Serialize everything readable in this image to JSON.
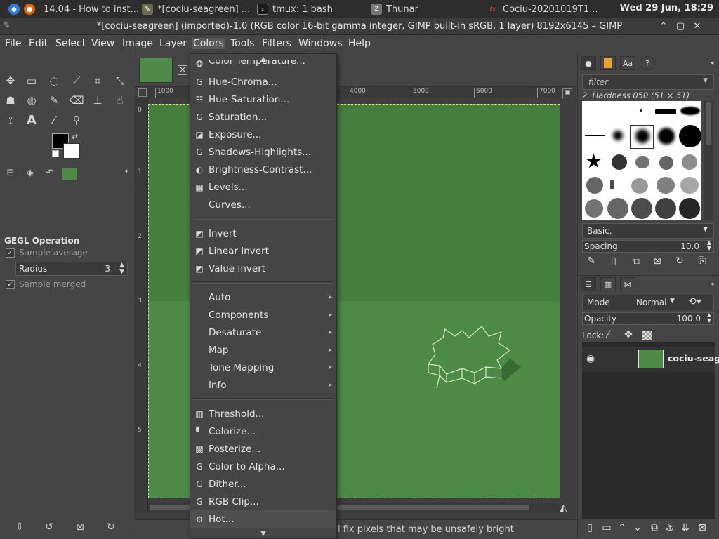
{
  "taskbar": {
    "items": [
      {
        "label": "14.04 - How to inst..."
      },
      {
        "label": "*[cociu-seagreen] ..."
      },
      {
        "label": "tmux: 1 bash"
      },
      {
        "label": "Thunar"
      },
      {
        "label": "Cociu-20201019T1..."
      }
    ],
    "thunar_badge": "2",
    "clock": "Wed 29 Jun, 18:29"
  },
  "window": {
    "title": "*[cociu-seagreen] (imported)-1.0 (RGB color 16-bit gamma integer, GIMP built-in sRGB, 1 layer) 8192x6145 – GIMP"
  },
  "menubar": [
    "File",
    "Edit",
    "Select",
    "View",
    "Image",
    "Layer",
    "Colors",
    "Tools",
    "Filters",
    "Windows",
    "Help"
  ],
  "tool_options": {
    "title": "GEGL Operation",
    "sample_average": "Sample average",
    "radius_label": "Radius",
    "radius_value": "3",
    "sample_merged": "Sample merged"
  },
  "rulers": {
    "h": [
      "1000",
      "4000",
      "5000",
      "6000",
      "7000"
    ],
    "v": [
      "0",
      "1",
      "2",
      "3",
      "4",
      "5"
    ]
  },
  "status": {
    "text": "l fix pixels that may be unsafely bright"
  },
  "colors_menu": {
    "top_partial": "Color Temperature...",
    "items_a": [
      "Hue-Chroma...",
      "Hue-Saturation...",
      "Saturation...",
      "Exposure...",
      "Shadows-Highlights...",
      "Brightness-Contrast...",
      "Levels...",
      "Curves..."
    ],
    "items_b": [
      "Invert",
      "Linear Invert",
      "Value Invert"
    ],
    "items_c": [
      "Auto",
      "Components",
      "Desaturate",
      "Map",
      "Tone Mapping",
      "Info"
    ],
    "items_d": [
      "Threshold...",
      "Colorize...",
      "Posterize...",
      "Color to Alpha...",
      "Dither...",
      "RGB Clip...",
      "Hot..."
    ]
  },
  "brushes": {
    "filter_placeholder": "filter",
    "selected_name": "2. Hardness 050 (51 × 51)",
    "tag": "Basic,",
    "spacing_label": "Spacing",
    "spacing_value": "10.0"
  },
  "layers": {
    "mode_label": "Mode",
    "mode_value": "Normal",
    "opacity_label": "Opacity",
    "opacity_value": "100.0",
    "lock_label": "Lock:",
    "layer_name": "cociu-seag"
  },
  "colors": {
    "canvas_green": "#4c8a45",
    "selection": "#e8e85a"
  }
}
